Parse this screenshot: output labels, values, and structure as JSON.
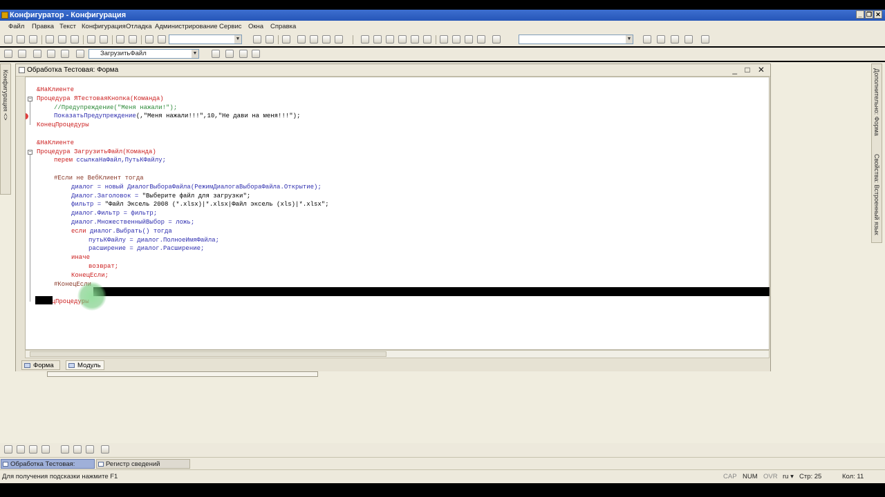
{
  "app": {
    "title": "Конфигуратор - Конфигурация"
  },
  "menu": [
    "Файл",
    "Правка",
    "Текст",
    "Конфигурация",
    "Отладка",
    "Администрирование",
    "Сервис",
    "Окна",
    "Справка"
  ],
  "toolbar2": {
    "combo_value": "ЗагрузитьФайл"
  },
  "left_panel": {
    "label": "Конфигурация <>"
  },
  "right_panel": {
    "label1": "Дополнительно: Форма",
    "label2": "Свойства: Встроенный язык"
  },
  "window": {
    "title": "Обработка Тестовая: Форма",
    "controls": "_ □ ✕"
  },
  "code": [
    {
      "t": "&НаКлиенте",
      "c": "kw",
      "i": 0
    },
    {
      "t": "Процедура",
      "c": "kw",
      "i": 0,
      "rest": " ЯТестоваяКнопка(Команда)",
      "rc": "kw"
    },
    {
      "t": "//Предупреждение(\"Меня нажали!\");",
      "c": "cm",
      "i": 1
    },
    {
      "t": "ПоказатьПредупреждение",
      "c": "id",
      "i": 1,
      "rest": "(,\"Меня нажали!!!\",10,\"Не дави на меня!!!\");",
      "rc": "str"
    },
    {
      "t": "КонецПроцедуры",
      "c": "kw",
      "i": 0
    },
    {
      "t": "",
      "c": "str",
      "i": 0
    },
    {
      "t": "&НаКлиенте",
      "c": "kw",
      "i": 0
    },
    {
      "t": "Процедура",
      "c": "kw",
      "i": 0,
      "rest": " ЗагрузитьФайл(Команда)",
      "rc": "kw"
    },
    {
      "t": "перем",
      "c": "kw",
      "i": 1,
      "rest": " ссылкаНаФайл,ПутьКФайлу;",
      "rc": "id"
    },
    {
      "t": "",
      "c": "str",
      "i": 0
    },
    {
      "t": "#Если не ВебКлиент тогда",
      "c": "pp",
      "i": 1
    },
    {
      "t": "диалог = новый ДиалогВыбораФайла(РежимДиалогаВыбораФайла.Открытие);",
      "c": "id",
      "i": 2
    },
    {
      "t": "Диалог.Заголовок = ",
      "c": "id",
      "i": 2,
      "rest": "\"Выберите файл для загрузки\";",
      "rc": "str"
    },
    {
      "t": "фильтр = ",
      "c": "id",
      "i": 2,
      "rest": "\"Файл Эксель 2008 (*.xlsx)|*.xlsx|Файл эксель (xls)|*.xlsx\";",
      "rc": "str"
    },
    {
      "t": "диалог.Фильтр = фильтр;",
      "c": "id",
      "i": 2
    },
    {
      "t": "диалог.МножественныйВыбор = ложь;",
      "c": "id",
      "i": 2
    },
    {
      "t": "если",
      "c": "kw",
      "i": 2,
      "rest": " диалог.Выбрать() тогда",
      "rc": "id"
    },
    {
      "t": "путьКФайлу = диалог.ПолноеИмяФайла;",
      "c": "id",
      "i": 3
    },
    {
      "t": "расширение = диалог.Расширение;",
      "c": "id",
      "i": 3
    },
    {
      "t": "иначе",
      "c": "kw",
      "i": 2
    },
    {
      "t": "возврат;",
      "c": "kw",
      "i": 3
    },
    {
      "t": "КонецЕсли;",
      "c": "kw",
      "i": 2
    },
    {
      "t": "#КонецЕсли",
      "c": "pp",
      "i": 1
    },
    {
      "t": "",
      "c": "str",
      "i": 0
    },
    {
      "t": "КонецПроцедуры",
      "c": "kw",
      "i": 0
    }
  ],
  "tabs": [
    "Форма",
    "Модуль"
  ],
  "taskbar": [
    "Обработка Тестовая: Форма",
    "Регистр сведений Файлово..."
  ],
  "status": {
    "hint": "Для получения подсказки нажмите F1",
    "cap": "CAP",
    "num": "NUM",
    "ovr": "OVR",
    "lang": "ru ▾",
    "line": "Стр: 25",
    "col": "Кол: 11"
  },
  "colors": {
    "keyword": "#cc2020",
    "identifier": "#3030b0",
    "comment": "#2e8b3a",
    "titlebar": "#2656b8"
  }
}
